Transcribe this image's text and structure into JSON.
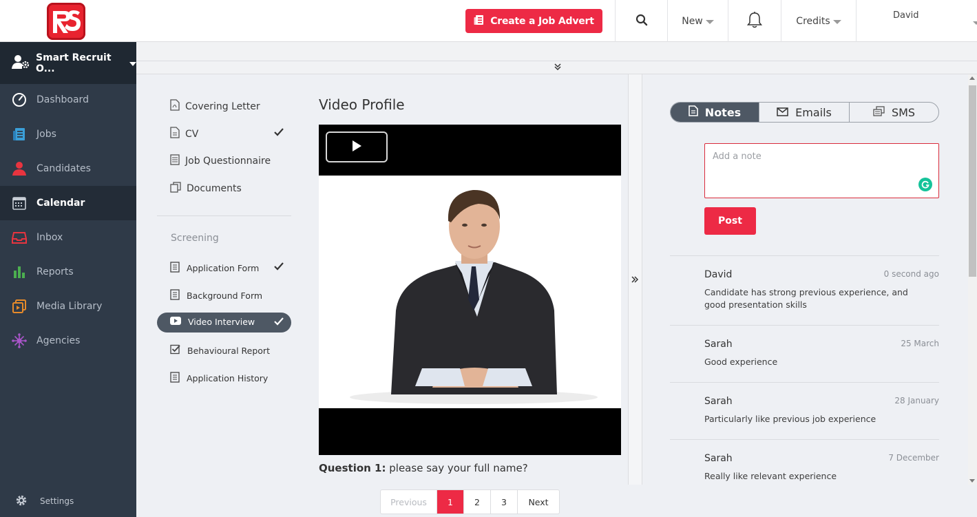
{
  "header": {
    "create_job_label": "Create a Job Advert",
    "new_label": "New",
    "credits_label": "Credits",
    "user_name": "David"
  },
  "sidebar": {
    "org_name": "Smart Recruit O...",
    "items": [
      {
        "label": "Dashboard",
        "icon": "gauge-icon",
        "color": "#ffffff"
      },
      {
        "label": "Jobs",
        "icon": "jobs-icon",
        "color": "#3b9fd8"
      },
      {
        "label": "Candidates",
        "icon": "person-icon",
        "color": "#e8343f"
      },
      {
        "label": "Calendar",
        "icon": "calendar-icon",
        "color": "#c8ced6"
      },
      {
        "label": "Inbox",
        "icon": "inbox-icon",
        "color": "#e8343f"
      },
      {
        "label": "Reports",
        "icon": "bar-chart-icon",
        "color": "#4caf50"
      },
      {
        "label": "Media Library",
        "icon": "media-icon",
        "color": "#e88b2a"
      },
      {
        "label": "Agencies",
        "icon": "network-icon",
        "color": "#a855c8"
      }
    ],
    "active": "Calendar",
    "settings_label": "Settings"
  },
  "documents": {
    "items": [
      "Covering Letter",
      "CV",
      "Job Questionnaire",
      "Documents"
    ],
    "screening_label": "Screening",
    "screening_items": [
      "Application Form",
      "Background Form",
      "Video Interview",
      "Behavioural Report",
      "Application History"
    ]
  },
  "video": {
    "title": "Video Profile",
    "question_label": "Question 1:",
    "question_text": " please say your full name?"
  },
  "pagination": {
    "previous": "Previous",
    "pages": [
      "1",
      "2",
      "3"
    ],
    "next": "Next",
    "current": "1"
  },
  "notes_panel": {
    "tabs": [
      "Notes",
      "Emails",
      "SMS"
    ],
    "active_tab": "Notes",
    "placeholder": "Add a note",
    "post_label": "Post",
    "notes": [
      {
        "author": "David",
        "time": "0 second ago",
        "text": "Candidate has strong previous experience, and good presentation skills"
      },
      {
        "author": "Sarah",
        "time": "25 March",
        "text": "Good experience"
      },
      {
        "author": "Sarah",
        "time": "28 January",
        "text": "Particularly like previous job experience"
      },
      {
        "author": "Sarah",
        "time": "7 December",
        "text": "Really like relevant experience"
      }
    ]
  },
  "colors": {
    "accent": "#ed2a45",
    "sidebar": "#2f3a48",
    "pill": "#4e5864"
  }
}
